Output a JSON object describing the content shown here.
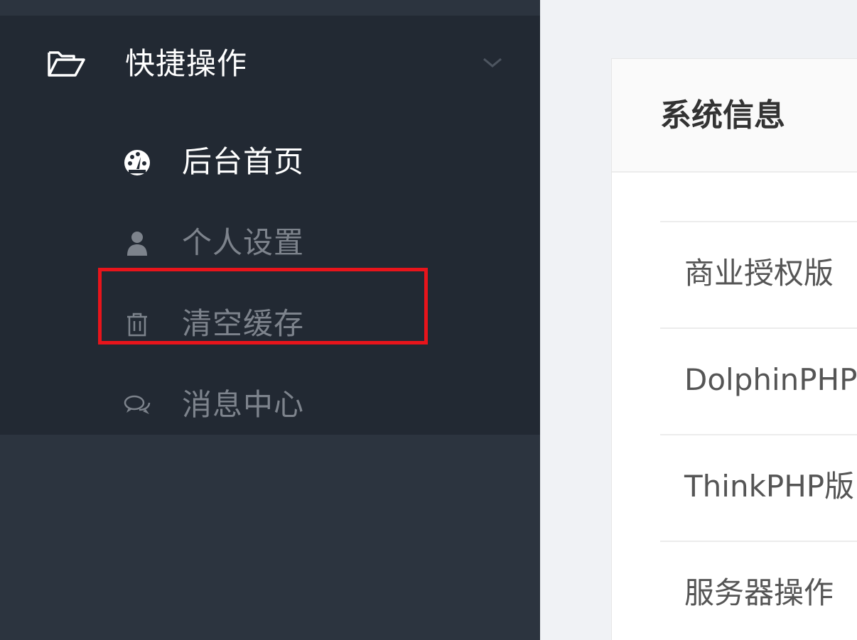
{
  "sidebar": {
    "group": {
      "label": "快捷操作",
      "icon": "folder-open-icon",
      "chevron": "chevron-down-icon"
    },
    "items": [
      {
        "label": "后台首页",
        "icon": "dashboard-icon",
        "active": true
      },
      {
        "label": "个人设置",
        "icon": "user-icon",
        "active": false
      },
      {
        "label": "清空缓存",
        "icon": "trash-icon",
        "active": false,
        "highlighted": true
      },
      {
        "label": "消息中心",
        "icon": "comments-icon",
        "active": false
      }
    ]
  },
  "main": {
    "card_title": "系统信息",
    "rows": [
      {
        "label": "商业授权版"
      },
      {
        "label": "DolphinPHP"
      },
      {
        "label": "ThinkPHP版"
      },
      {
        "label": "服务器操作"
      }
    ]
  },
  "colors": {
    "sidebar_bg": "#2c343f",
    "menu_bg": "#222933",
    "active_text": "#ffffff",
    "inactive_text": "#7d838c",
    "highlight": "#e8141b"
  }
}
